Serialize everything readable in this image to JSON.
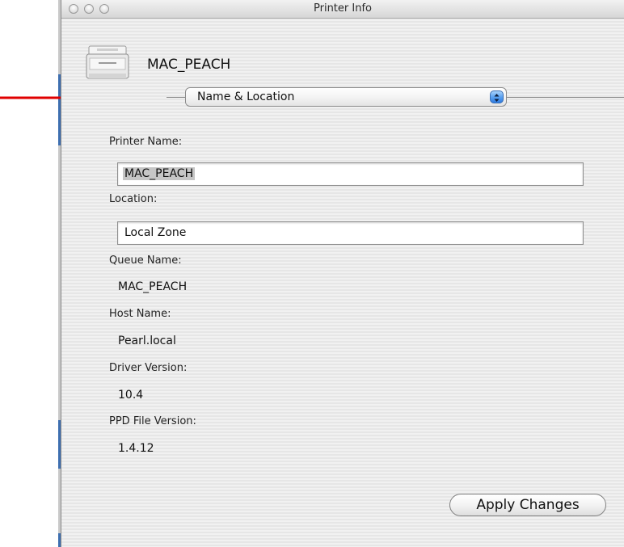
{
  "window": {
    "title": "Printer Info"
  },
  "header": {
    "printer_name": "MAC_PEACH"
  },
  "popup": {
    "selected": "Name & Location"
  },
  "fields": {
    "printer_name_label": "Printer Name:",
    "printer_name_value": "MAC_PEACH",
    "location_label": "Location:",
    "location_value": "Local Zone",
    "queue_name_label": "Queue Name:",
    "queue_name_value": "MAC_PEACH",
    "host_name_label": "Host Name:",
    "host_name_value": "Pearl.local",
    "driver_version_label": "Driver Version:",
    "driver_version_value": "10.4",
    "ppd_version_label": "PPD File Version:",
    "ppd_version_value": "1.4.12"
  },
  "buttons": {
    "apply": "Apply Changes"
  },
  "icons": {
    "printer": "printer-icon",
    "popup_arrows": "up-down-arrows-icon",
    "annotation": "red-arrow-icon"
  },
  "colors": {
    "annotation_arrow": "#e00000",
    "popup_accent": "#3b86e8"
  }
}
